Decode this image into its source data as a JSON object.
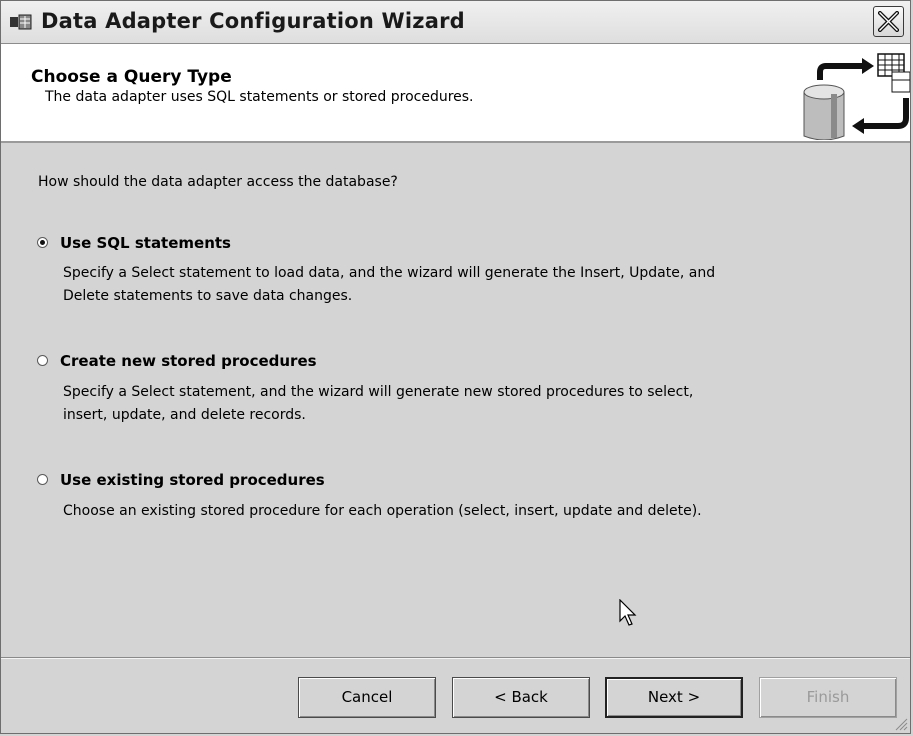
{
  "window": {
    "title": "Data Adapter Configuration Wizard",
    "icons": {
      "app": "app-icon",
      "close": "close-icon"
    }
  },
  "header": {
    "title": "Choose a Query Type",
    "subtitle": "The data adapter uses SQL statements or stored procedures.",
    "art": "database-table-exchange-icon"
  },
  "content": {
    "question": "How should the data adapter access the database?",
    "options": [
      {
        "label": "Use SQL statements",
        "selected": true,
        "description_lines": [
          "Specify a Select statement to load data, and the wizard will generate the Insert, Update, and",
          "Delete statements to save data changes."
        ]
      },
      {
        "label": "Create new stored procedures",
        "selected": false,
        "description_lines": [
          "Specify a Select statement, and the wizard will generate new stored procedures to select,",
          "insert, update, and delete records."
        ]
      },
      {
        "label": "Use existing stored procedures",
        "selected": false,
        "description_lines": [
          "Choose an existing stored procedure for each operation (select, insert, update and delete)."
        ]
      }
    ]
  },
  "buttons": {
    "cancel": "Cancel",
    "back": "< Back",
    "next": "Next >",
    "finish": "Finish"
  },
  "colors": {
    "face": "#d4d4d4",
    "header_bg": "#ffffff",
    "disabled_text": "#9a9a9a"
  }
}
